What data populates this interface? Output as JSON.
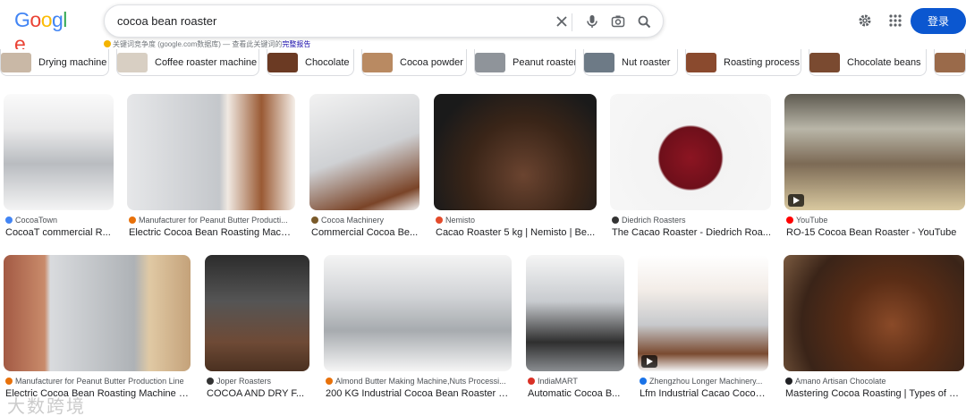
{
  "logo": {
    "text": "Google",
    "colors": [
      "#4285f4",
      "#ea4335",
      "#fbbc05",
      "#4285f4",
      "#34a853",
      "#ea4335"
    ]
  },
  "search": {
    "query": "cocoa bean roaster"
  },
  "notice": {
    "prefix": "关键词竞争度",
    "domain": "(google.com数据库)",
    "middle": "— 查看此关键词的",
    "link": "完整报告"
  },
  "header": {
    "login_label": "登录"
  },
  "chips": [
    {
      "label": "Drying machine",
      "thumb": "#c9b8a6"
    },
    {
      "label": "Coffee roaster machine",
      "thumb": "#d8cfc3"
    },
    {
      "label": "Chocolate",
      "thumb": "#6b3a23"
    },
    {
      "label": "Cocoa powder",
      "thumb": "#b98a62"
    },
    {
      "label": "Peanut roaster",
      "thumb": "#8f949a"
    },
    {
      "label": "Nut roaster",
      "thumb": "#6d7a86"
    },
    {
      "label": "Roasting process",
      "thumb": "#8a4a2e"
    },
    {
      "label": "Chocolate beans",
      "thumb": "#7a4a30"
    }
  ],
  "results_row1": [
    {
      "source": "CocoaTown",
      "fav": "#4285f4",
      "title": "CocoaT commercial R...",
      "video": false
    },
    {
      "source": "Manufacturer for Peanut Butter Producti...",
      "fav": "#e8710a",
      "title": "Electric Cocoa Bean Roasting Machi...",
      "video": false
    },
    {
      "source": "Cocoa Machinery",
      "fav": "#7a5a2a",
      "title": "Commercial Cocoa Be...",
      "video": false
    },
    {
      "source": "Nemisto",
      "fav": "#e34a2a",
      "title": "Cacao Roaster 5 kg | Nemisto | Be...",
      "video": false
    },
    {
      "source": "Diedrich Roasters",
      "fav": "#333333",
      "title": "The Cacao Roaster - Diedrich Roa...",
      "video": false
    },
    {
      "source": "YouTube",
      "fav": "#ff0000",
      "title": "RO-15 Cocoa Bean Roaster - YouTube",
      "video": true
    }
  ],
  "results_row2": [
    {
      "source": "Manufacturer for Peanut Butter Production Line",
      "fav": "#e8710a",
      "title": "Electric Cocoa Bean Roasting Machine Pr...",
      "video": false
    },
    {
      "source": "Joper Roasters",
      "fav": "#333333",
      "title": "COCOA AND DRY F...",
      "video": false
    },
    {
      "source": "Almond Butter Making Machine,Nuts Processi...",
      "fav": "#e8710a",
      "title": "200 KG Industrial Cocoa Bean Roaster M...",
      "video": false
    },
    {
      "source": "IndiaMART",
      "fav": "#d93025",
      "title": "Automatic Cocoa B...",
      "video": false
    },
    {
      "source": "Zhengzhou Longer Machinery...",
      "fav": "#1a73e8",
      "title": "Lfm Industrial Cacao Cocoa...",
      "video": true
    },
    {
      "source": "Amano Artisan Chocolate",
      "fav": "#202124",
      "title": "Mastering Cocoa Roasting | Types of Be...",
      "video": false
    }
  ],
  "watermark": "大数跨境"
}
